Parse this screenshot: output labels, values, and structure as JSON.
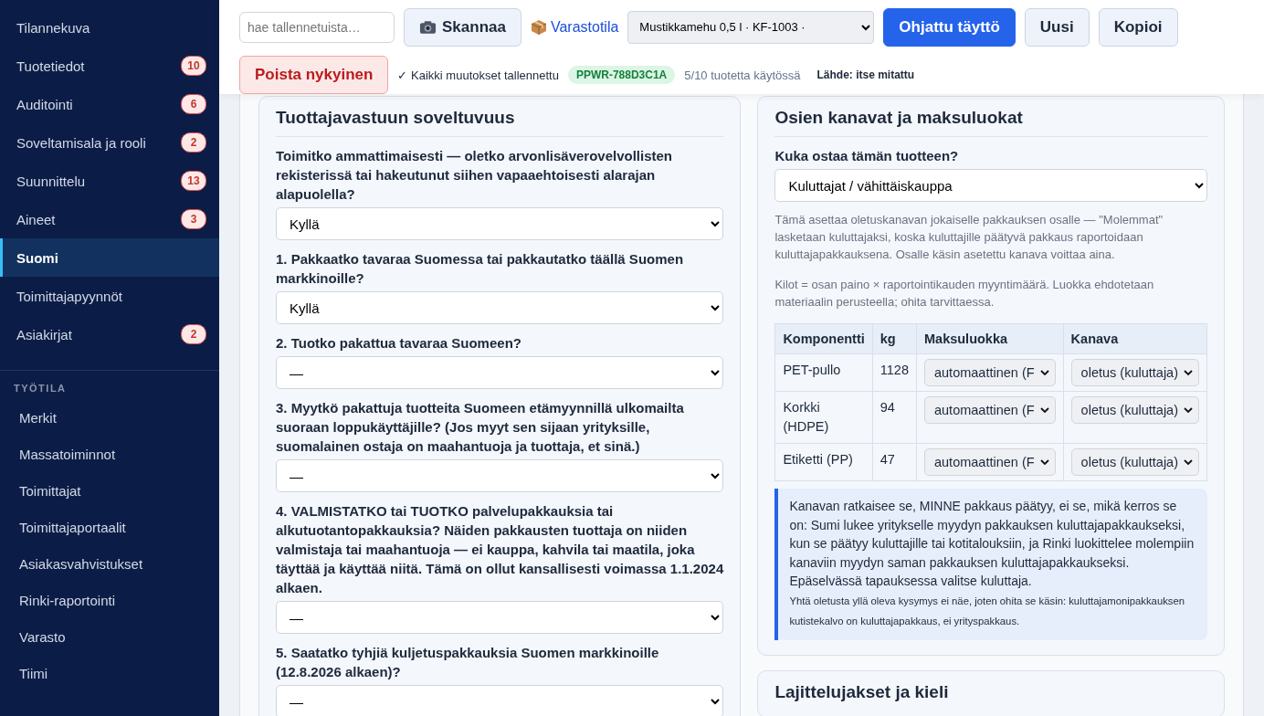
{
  "sidebar": {
    "items": [
      {
        "label": "Tilannekuva",
        "selected": false
      },
      {
        "label": "Tuotetiedot",
        "badge": "10",
        "selected": false
      },
      {
        "label": "Auditointi",
        "badge": "6",
        "selected": false
      },
      {
        "label": "Soveltamisala ja rooli",
        "badge": "2",
        "selected": false
      },
      {
        "label": "Suunnittelu",
        "badge": "13",
        "selected": false
      },
      {
        "label": "Aineet",
        "badge": "3",
        "selected": false
      },
      {
        "label": "Suomi",
        "selected": true
      },
      {
        "label": "Toimittajapyynnöt",
        "selected": false
      },
      {
        "label": "Asiakirjat",
        "badge": "2",
        "selected": false
      }
    ],
    "section_title": "TYÖTILA",
    "workspace_items": [
      {
        "label": "Merkit",
        "selected": false
      },
      {
        "label": "Massatoiminnot",
        "selected": false
      },
      {
        "label": "Toimittajat",
        "selected": false
      },
      {
        "label": "Toimittajaportaalit",
        "selected": false
      },
      {
        "label": "Asiakasvahvistukset",
        "selected": false
      },
      {
        "label": "Rinki-raportointi",
        "selected": false
      },
      {
        "label": "Varasto",
        "selected": false
      },
      {
        "label": "Tiimi",
        "selected": false
      }
    ]
  },
  "toolbar": {
    "search": {
      "placeholder": "hae tallennetuista…"
    },
    "scan_button": "Skannaa",
    "stock_link": "Varastotila",
    "product_select": "Mustikkamehu 0,5 l · KF-1003 ·",
    "guided_button": "Ohjattu täyttö",
    "new_button": "Uusi",
    "copy_button": "Kopioi",
    "delete_button": "Poista nykyinen",
    "save_status": "✓ Kaikki muutokset tallennettu",
    "product_id": "PPWR-788D3C1A",
    "usage": "5/10 tuotetta käytössä",
    "source": "Lähde: itse mitattu"
  },
  "responsibility_card": {
    "title": "Tuottajavastuun soveltuvuus",
    "questions": [
      {
        "label": "Toimitko ammattimaisesti — oletko arvonlisäverovelvollisten rekisterissä tai hakeutunut siihen vapaaehtoisesti alarajan alapuolella?",
        "value": "Kyllä"
      },
      {
        "label": "1. Pakkaatko tavaraa Suomessa tai pakkautatko täällä Suomen markkinoille?",
        "value": "Kyllä"
      },
      {
        "label": "2. Tuotko pakattua tavaraa Suomeen?",
        "value": "—"
      },
      {
        "label": "3. Myytkö pakattuja tuotteita Suomeen etämyynnillä ulkomailta suoraan loppukäyttäjille? (Jos myyt sen sijaan yrityksille, suomalainen ostaja on maahantuoja ja tuottaja, et sinä.)",
        "value": "—"
      },
      {
        "label": "4. VALMISTATKO tai TUOTKO palvelupakkauksia tai alkutuotantopakkauksia? Näiden pakkausten tuottaja on niiden valmistaja tai maahantuoja — ei kauppa, kahvila tai maatila, joka täyttää ja käyttää niitä. Tämä on ollut kansallisesti voimassa 1.1.2024 alkaen.",
        "value": "—"
      },
      {
        "label": "5. Saatatko tyhjiä kuljetuspakkauksia Suomen markkinoille (12.8.2026 alkaen)?",
        "value": "—"
      }
    ]
  },
  "channels_card": {
    "title": "Osien kanavat ja maksuluokat",
    "question": "Kuka ostaa tämän tuotteen?",
    "buyer": "Kuluttajat / vähittäiskauppa",
    "notes": [
      "Tämä asettaa oletuskanavan jokaiselle pakkauksen osalle — \"Molemmat\" lasketaan kuluttajaksi, koska kuluttajille päätyvä pakkaus raportoidaan kuluttajapakkauksena. Osalle käsin asetettu kanava voittaa aina.",
      "Kilot = osan paino × raportointikauden myyntimäärä. Luokka ehdotetaan materiaalin perusteella; ohita tarvittaessa."
    ],
    "table": {
      "columns": [
        "Komponentti",
        "kg",
        "Maksuluokka",
        "Kanava"
      ],
      "rows": [
        {
          "component": "PET-pullo",
          "kg": "1128",
          "fee_class": "automaattinen (F",
          "channel": "oletus (kuluttaja)"
        },
        {
          "component": "Korkki (HDPE)",
          "kg": "94",
          "fee_class": "automaattinen (F",
          "channel": "oletus (kuluttaja)"
        },
        {
          "component": "Etiketti (PP)",
          "kg": "47",
          "fee_class": "automaattinen (F",
          "channel": "oletus (kuluttaja)"
        }
      ]
    },
    "info": {
      "text": "Kanavan ratkaisee se, MINNE pakkaus päätyy, ei se, mikä kerros se on: Sumi lukee yritykselle myydyn pakkauksen kuluttajapakkaukseksi, kun se päätyy kuluttajille tai kotitalouksiin, ja Rinki luokittelee molempiin kanaviin myydyn saman pakkauksen kuluttajapakkaukseksi. Epäselvässä tapauksessa valitse kuluttaja.",
      "note": "Yhtä oletusta yllä oleva kysymys ei näe, joten ohita se käsin: kuluttajamonipakkauksen kutistekalvo on kuluttajapakkaus, ei yrityspakkaus."
    }
  },
  "next_card": {
    "title": "Lajittelujakset ja kieli"
  }
}
